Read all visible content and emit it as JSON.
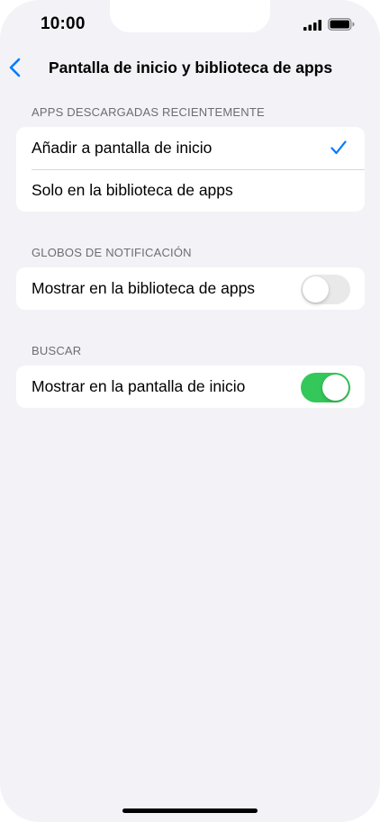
{
  "status_bar": {
    "time": "10:00",
    "signal_icon": "cellular-signal-icon",
    "battery_icon": "battery-full-icon"
  },
  "nav": {
    "back_icon": "chevron-left-icon",
    "title": "Pantalla de inicio y biblioteca de apps"
  },
  "sections": {
    "downloaded": {
      "header": "APPS DESCARGADAS RECIENTEMENTE",
      "options": [
        {
          "label": "Añadir a pantalla de inicio",
          "selected": true
        },
        {
          "label": "Solo en la biblioteca de apps",
          "selected": false
        }
      ]
    },
    "badges": {
      "header": "GLOBOS DE NOTIFICACIÓN",
      "toggle_label": "Mostrar en la biblioteca de apps",
      "toggle_on": false
    },
    "search": {
      "header": "BUSCAR",
      "toggle_label": "Mostrar en la pantalla de inicio",
      "toggle_on": true
    }
  },
  "colors": {
    "accent": "#007aff",
    "toggle_on": "#34c759",
    "toggle_off": "#e9e9ea",
    "background": "#f2f2f7"
  }
}
